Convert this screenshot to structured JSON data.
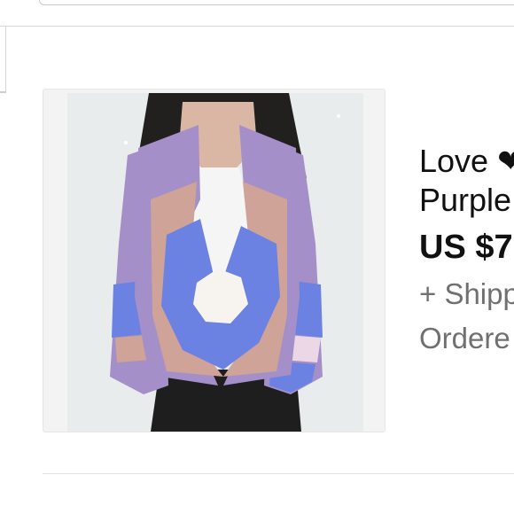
{
  "listing": {
    "title_line_1": "Love ❤",
    "title_line_2": "Purple",
    "price": "US $7",
    "shipping": "+ Shipp",
    "ordered": "Ordere"
  },
  "colors": {
    "title_text": "#111111",
    "secondary_text": "#707070",
    "border": "#d8d8d8",
    "sweater_lavender": "#a58fc8",
    "sweater_tan": "#cfa397",
    "sweater_blue": "#6b82e3"
  }
}
